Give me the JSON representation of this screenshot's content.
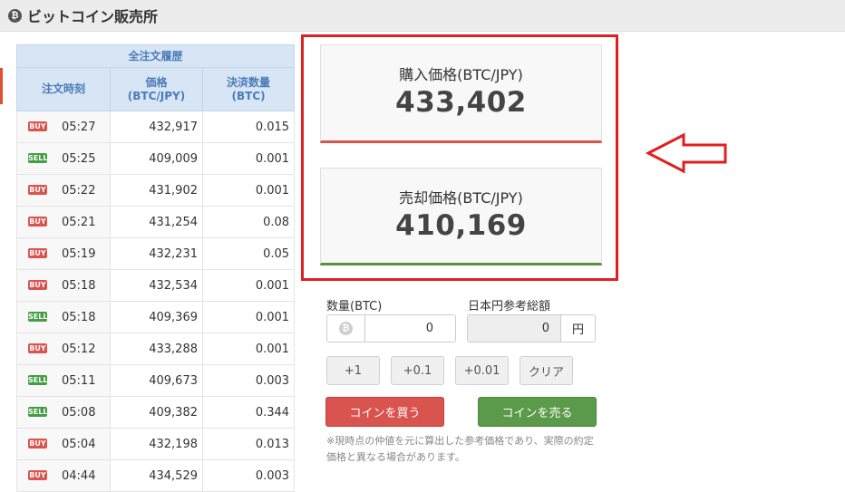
{
  "header": {
    "icon": "bitcoin-icon",
    "title": "ビットコイン販売所"
  },
  "orders": {
    "group_header": "全注文履歴",
    "columns": {
      "time": "注文時刻",
      "price_l1": "価格",
      "price_l2": "(BTC/JPY)",
      "qty_l1": "決済数量",
      "qty_l2": "(BTC)"
    },
    "rows": [
      {
        "side": "BUY",
        "time": "05:27",
        "price": "432,917",
        "qty": "0.015"
      },
      {
        "side": "SELL",
        "time": "05:25",
        "price": "409,009",
        "qty": "0.001"
      },
      {
        "side": "BUY",
        "time": "05:22",
        "price": "431,902",
        "qty": "0.001"
      },
      {
        "side": "BUY",
        "time": "05:21",
        "price": "431,254",
        "qty": "0.08"
      },
      {
        "side": "BUY",
        "time": "05:19",
        "price": "432,231",
        "qty": "0.05"
      },
      {
        "side": "BUY",
        "time": "05:18",
        "price": "432,534",
        "qty": "0.001"
      },
      {
        "side": "SELL",
        "time": "05:18",
        "price": "409,369",
        "qty": "0.001"
      },
      {
        "side": "BUY",
        "time": "05:12",
        "price": "433,288",
        "qty": "0.001"
      },
      {
        "side": "SELL",
        "time": "05:11",
        "price": "409,673",
        "qty": "0.003"
      },
      {
        "side": "SELL",
        "time": "05:08",
        "price": "409,382",
        "qty": "0.344"
      },
      {
        "side": "BUY",
        "time": "05:04",
        "price": "432,198",
        "qty": "0.013"
      },
      {
        "side": "BUY",
        "time": "04:44",
        "price": "434,529",
        "qty": "0.003"
      }
    ]
  },
  "prices": {
    "buy_label": "購入価格(BTC/JPY)",
    "buy_price": "433,402",
    "sell_label": "売却価格(BTC/JPY)",
    "sell_price": "410,169"
  },
  "form": {
    "qty_label": "数量(BTC)",
    "qty_value": "0",
    "jpy_label": "日本円参考総額",
    "jpy_value": "0",
    "yen_unit": "円",
    "increments": [
      "+1",
      "+0.1",
      "+0.01"
    ],
    "clear": "クリア",
    "buy_button": "コインを買う",
    "sell_button": "コインを売る",
    "note": "※現時点の仲値を元に算出した参考価格であり、実際の約定価格と異なる場合があります。"
  },
  "colors": {
    "buy": "#d9534f",
    "sell": "#5a9a4a",
    "highlight": "#e02020",
    "header_bg": "#d7e5f4"
  }
}
